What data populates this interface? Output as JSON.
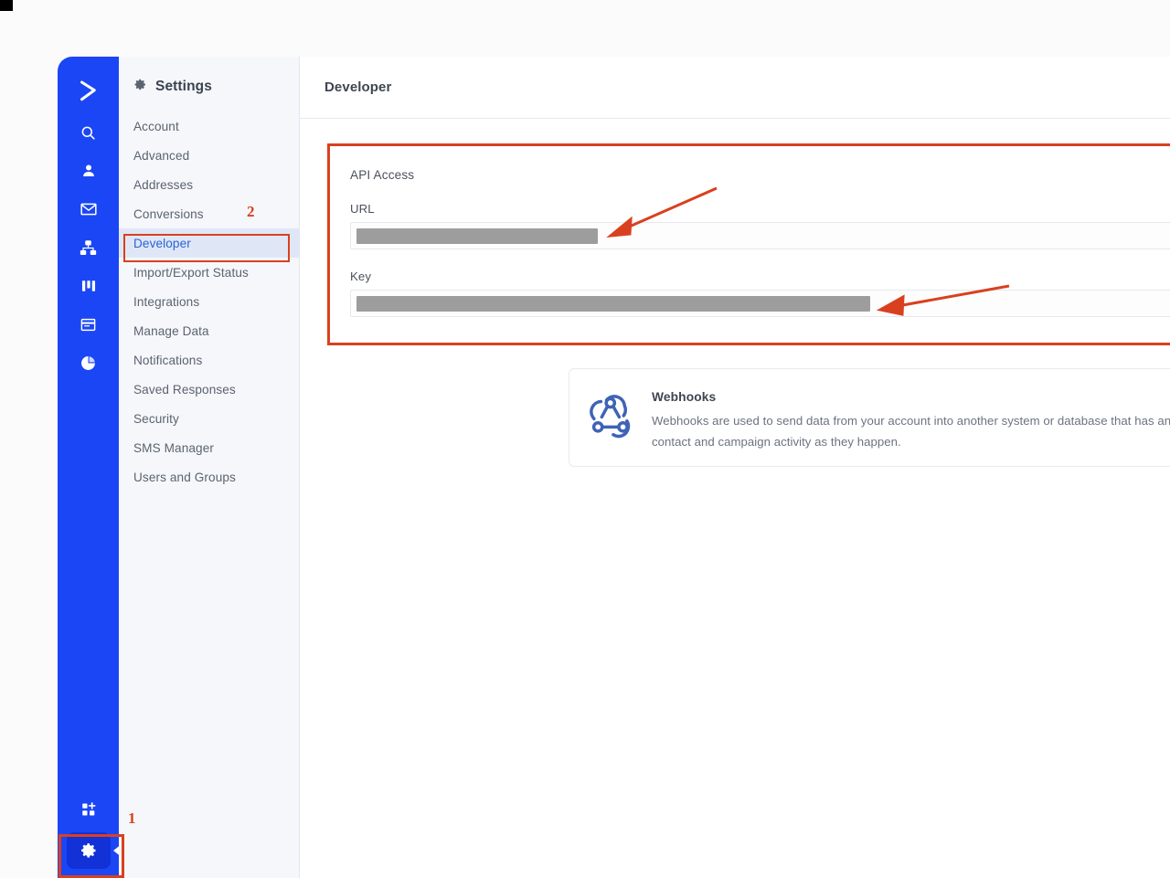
{
  "app": {
    "brand_color": "#1b46f5",
    "logo_icon": "chevron-right-logo"
  },
  "rail": {
    "items": [
      {
        "icon": "search-icon",
        "name": "search"
      },
      {
        "icon": "contact-person-icon",
        "name": "contacts"
      },
      {
        "icon": "envelope-icon",
        "name": "campaigns"
      },
      {
        "icon": "automations-sitemap-icon",
        "name": "automations"
      },
      {
        "icon": "deals-columns-icon",
        "name": "deals"
      },
      {
        "icon": "website-pages-icon",
        "name": "website"
      },
      {
        "icon": "pie-chart-icon",
        "name": "reports"
      }
    ],
    "bottom": [
      {
        "icon": "apps-plus-icon",
        "name": "apps"
      },
      {
        "icon": "gear-icon",
        "name": "settings"
      }
    ]
  },
  "sidebar": {
    "header_icon": "gear-icon",
    "header_title": "Settings",
    "items": [
      {
        "label": "Account",
        "active": false
      },
      {
        "label": "Advanced",
        "active": false
      },
      {
        "label": "Addresses",
        "active": false
      },
      {
        "label": "Conversions",
        "active": false
      },
      {
        "label": "Developer",
        "active": true
      },
      {
        "label": "Import/Export Status",
        "active": false
      },
      {
        "label": "Integrations",
        "active": false
      },
      {
        "label": "Manage Data",
        "active": false
      },
      {
        "label": "Notifications",
        "active": false
      },
      {
        "label": "Saved Responses",
        "active": false
      },
      {
        "label": "Security",
        "active": false
      },
      {
        "label": "SMS Manager",
        "active": false
      },
      {
        "label": "Users and Groups",
        "active": false
      }
    ]
  },
  "main": {
    "page_title": "Developer",
    "api_section": {
      "title": "API Access",
      "url_label": "URL",
      "url_value": "",
      "key_label": "Key",
      "key_value": ""
    },
    "webhooks": {
      "icon": "webhook-icon",
      "title": "Webhooks",
      "description_line1": "Webhooks are used to send data from your account into another system or database that has an API that can listen for webhooks.",
      "description_line2": "contact and campaign activity as they happen."
    }
  },
  "annotations": {
    "color": "#d9401f",
    "step_1": "1",
    "step_2": "2"
  }
}
